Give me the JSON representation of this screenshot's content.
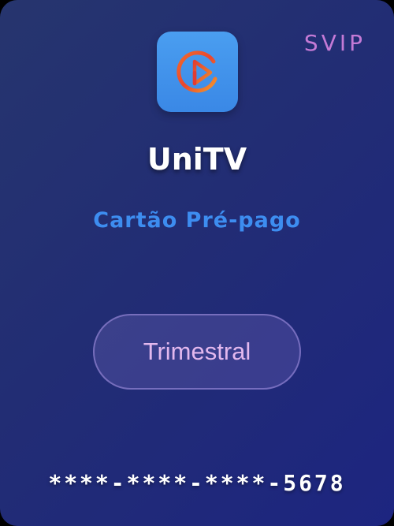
{
  "card": {
    "tier_badge": "SVIP",
    "app_name": "UniTV",
    "subtitle": "Cartão Pré-pago",
    "plan": {
      "label": "Trimestral"
    },
    "card_number": "****-****-****-5678",
    "logo": {
      "icon": "play-circle-logo-icon",
      "colors": {
        "background": "#3f94ec",
        "ring_start": "#e8462f",
        "ring_end": "#f59a2a"
      }
    }
  },
  "colors": {
    "card_background": "#222d74",
    "badge": "#c47ad6",
    "subtitle": "#3d8df0",
    "plan_label": "#e3b8ee"
  }
}
